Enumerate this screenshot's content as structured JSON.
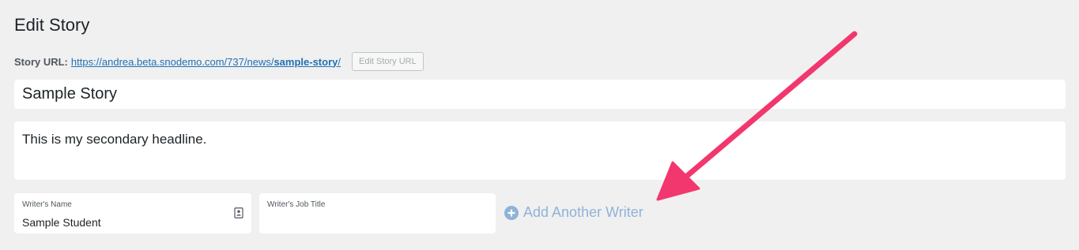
{
  "page": {
    "title": "Edit Story"
  },
  "story_url": {
    "label": "Story URL:",
    "prefix": "https://andrea.beta.snodemo.com/737/news/",
    "slug": "sample-story",
    "suffix": "/",
    "edit_button_label": "Edit Story URL"
  },
  "headline": {
    "value": "Sample Story"
  },
  "secondary_headline": {
    "value": "This is my secondary headline."
  },
  "writer": {
    "name_label": "Writer's Name",
    "name_value": "Sample Student",
    "job_title_label": "Writer's Job Title",
    "job_title_value": ""
  },
  "add_writer": {
    "label": "Add Another Writer",
    "icon": "plus-circle-icon"
  },
  "colors": {
    "background": "#f0f0f1",
    "link": "#2271b1",
    "add_writer": "#8fb3d6",
    "annotation_arrow": "#f2376e"
  },
  "annotation": {
    "icon": "arrow-icon"
  }
}
